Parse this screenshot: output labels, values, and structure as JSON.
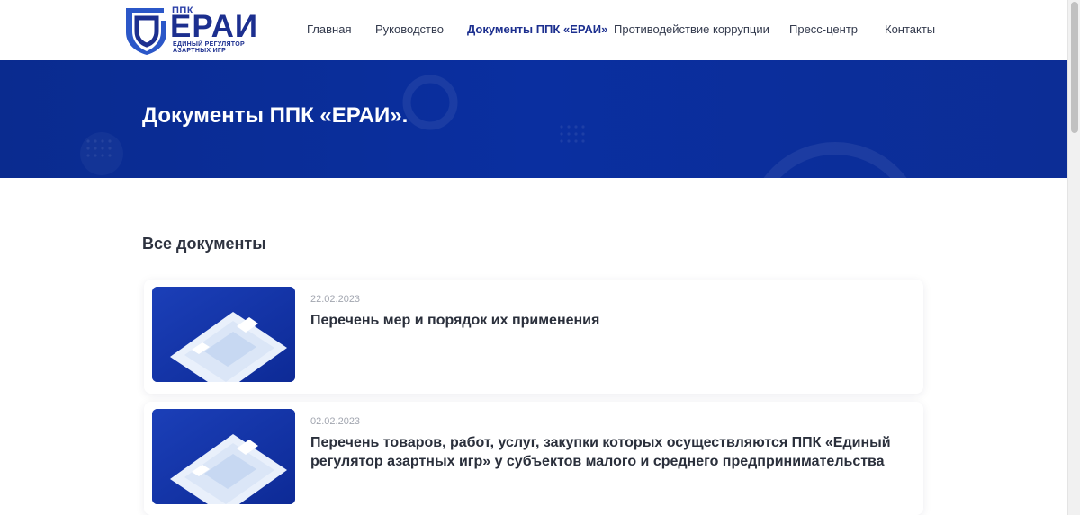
{
  "logo": {
    "ppk": "ППК",
    "name": "ЕРАИ",
    "subtitle_line1": "Единый регулятор",
    "subtitle_line2": "азартных игр"
  },
  "nav": {
    "items": [
      {
        "label": "Главная",
        "active": false
      },
      {
        "label": "Руководство",
        "active": false
      },
      {
        "label": "Документы ППК «ЕРАИ»",
        "active": true
      },
      {
        "label": "Противодействие коррупции",
        "active": false
      },
      {
        "label": "Пресс-центр",
        "active": false
      },
      {
        "label": "Контакты",
        "active": false
      }
    ]
  },
  "banner": {
    "title": "Документы ППК «ЕРАИ»."
  },
  "documents": {
    "section_title": "Все документы",
    "items": [
      {
        "date": "22.02.2023",
        "title": "Перечень мер и порядок их применения"
      },
      {
        "date": "02.02.2023",
        "title": "Перечень товаров, работ, услуг, закупки которых осуществляются ППК «Единый регулятор азартных игр» у субъектов малого и среднего предпринимательства"
      }
    ]
  },
  "colors": {
    "brand_blue": "#1c2f8f",
    "banner_blue": "#0a2fa0",
    "text_dark": "#2a2f3b",
    "date_gray": "#a2a6b0"
  }
}
